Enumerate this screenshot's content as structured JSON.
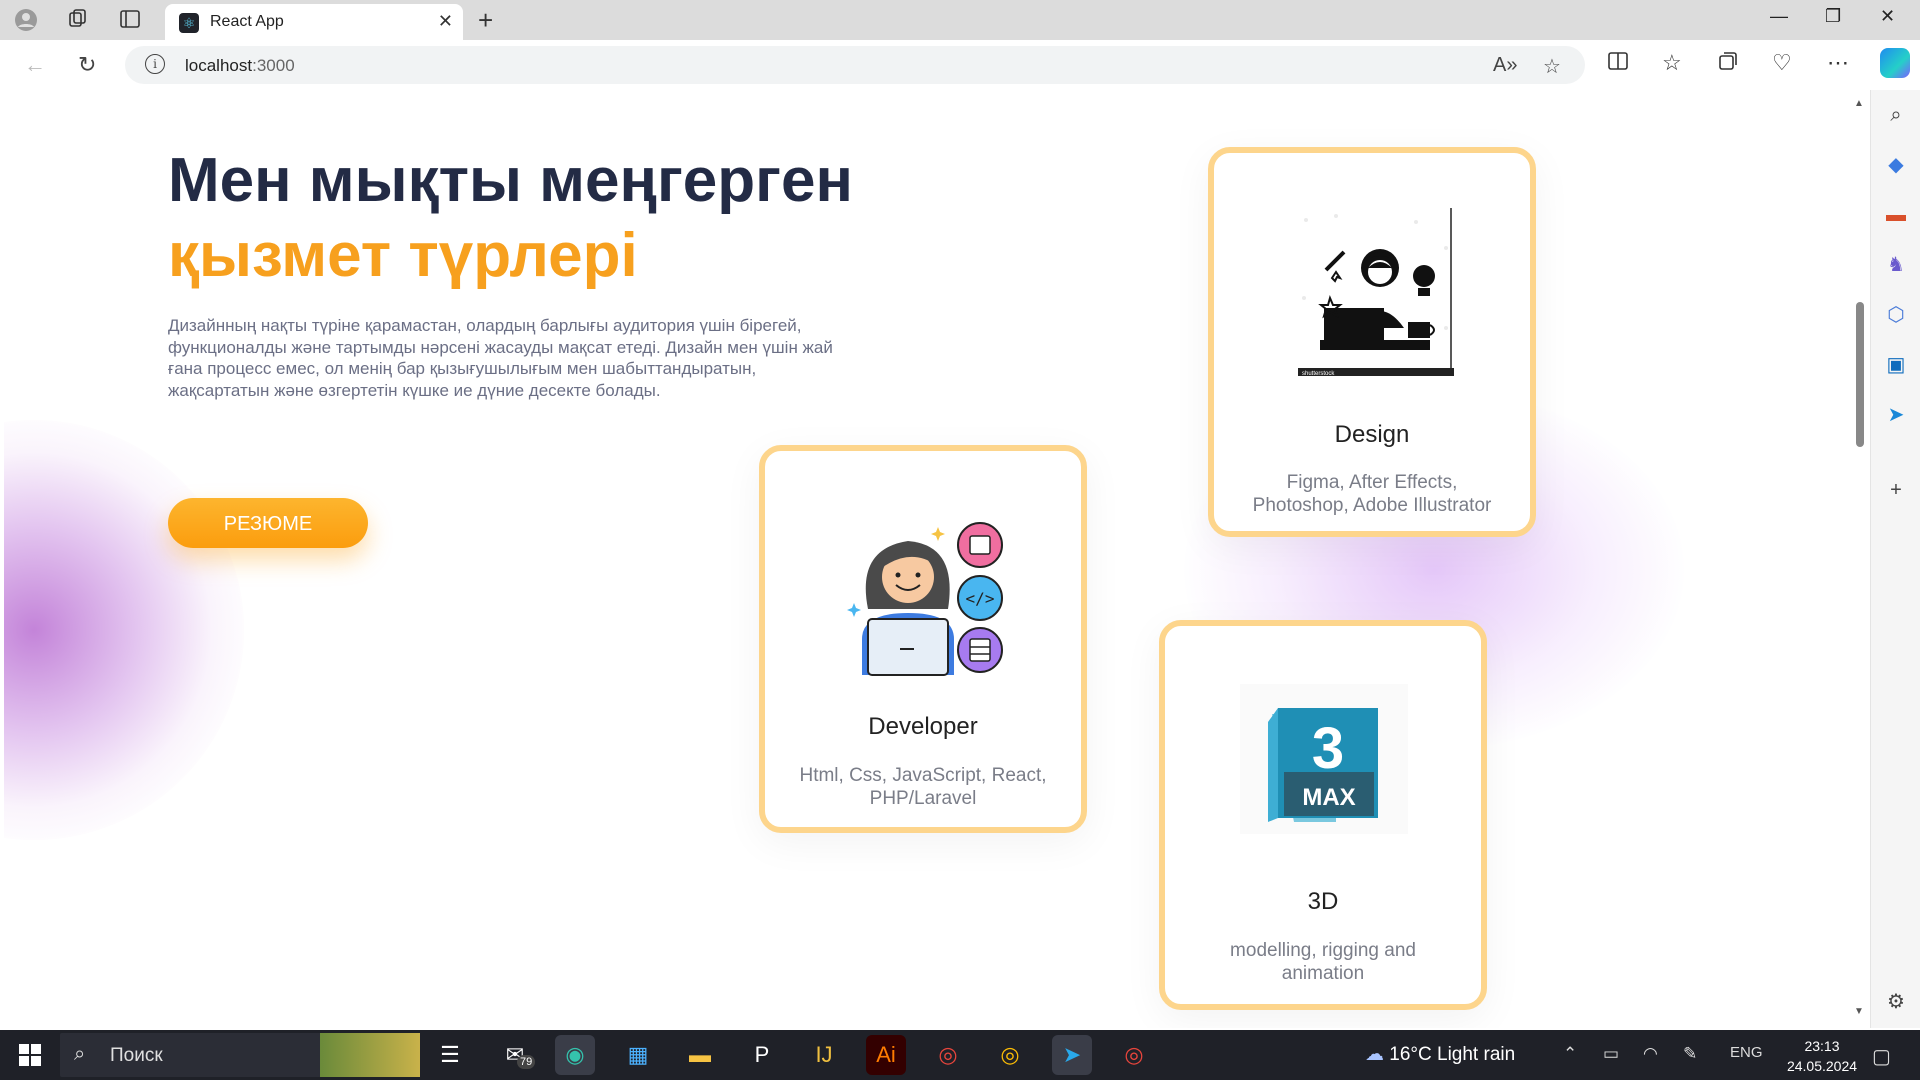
{
  "browser": {
    "tab_title": "React App",
    "url_host": "localhost",
    "url_port": ":3000"
  },
  "page": {
    "heading_line1": "Мен мықты меңгерген",
    "heading_line2": "қызмет түрлері",
    "description": "Дизайнның нақты түріне қарамастан, олардың барлығы аудитория үшін бірегей, функционалды және тартымды нәрсені жасауды мақсат етеді. Дизайн мен үшін жай ғана процесс емес, ол менің бар қызығушылығым мен шабыттандыратын, жақсартатын және өзгертетін күшке ие дүние десекте болады.",
    "resume_button": "РЕЗЮМЕ",
    "cards": [
      {
        "title": "Design",
        "description": "Figma, After Effects, Photoshop, Adobe Illustrator",
        "image_caption": "shutterstock"
      },
      {
        "title": "Developer",
        "description": "Html, Css, JavaScript, React, PHP/Laravel"
      },
      {
        "title": "3D",
        "description": "modelling, rigging and animation",
        "logo_number": "3",
        "logo_text": "MAX"
      }
    ]
  },
  "taskbar": {
    "search_placeholder": "Поиск",
    "mail_badge": "79",
    "weather": "16°C  Light rain",
    "language": "ENG",
    "time": "23:13",
    "date": "24.05.2024"
  },
  "colors": {
    "heading_dark": "#232b45",
    "heading_accent": "#f7a01e",
    "card_border": "#fdd58c",
    "button": "#fb9d0e"
  }
}
